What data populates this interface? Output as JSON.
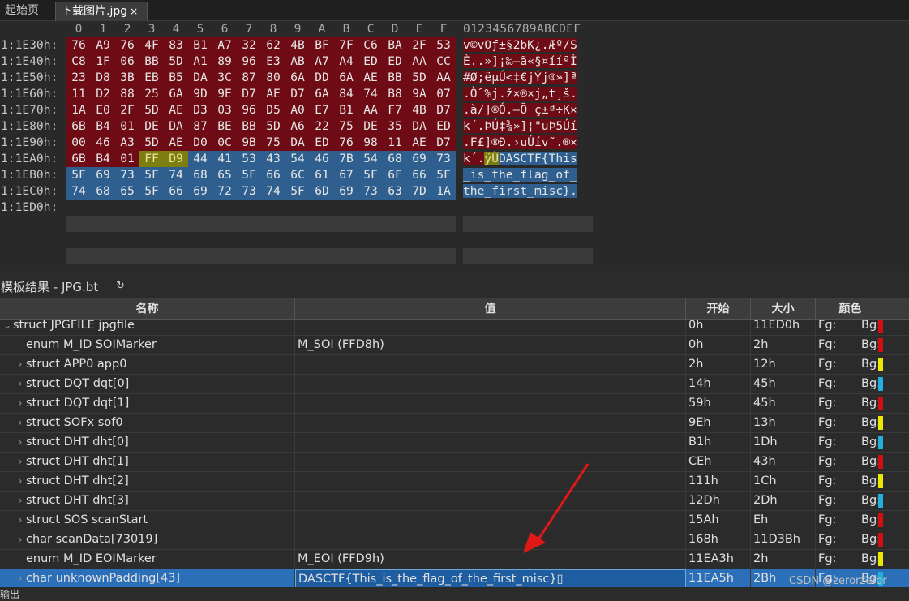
{
  "tabs": [
    {
      "label": "起始页",
      "close": ""
    },
    {
      "label": "下载图片.jpg",
      "close": "×"
    }
  ],
  "hex": {
    "col_headers": [
      "0",
      "1",
      "2",
      "3",
      "4",
      "5",
      "6",
      "7",
      "8",
      "9",
      "A",
      "B",
      "C",
      "D",
      "E",
      "F"
    ],
    "ascii_header": "0123456789ABCDEF",
    "rows": [
      {
        "addr": "1:1E30h:",
        "bytes": [
          "76",
          "A9",
          "76",
          "4F",
          "83",
          "B1",
          "A7",
          "32",
          "62",
          "4B",
          "BF",
          "7F",
          "C6",
          "BA",
          "2F",
          "53"
        ],
        "hl": [
          "r",
          "r",
          "r",
          "r",
          "r",
          "r",
          "r",
          "r",
          "r",
          "r",
          "r",
          "r",
          "r",
          "r",
          "r",
          "r"
        ],
        "ascii": "v©vOƒ±§2bK¿.Æº/S",
        "ascii_hl": "r"
      },
      {
        "addr": "1:1E40h:",
        "bytes": [
          "C8",
          "1F",
          "06",
          "BB",
          "5D",
          "A1",
          "89",
          "96",
          "E3",
          "AB",
          "A7",
          "A4",
          "ED",
          "ED",
          "AA",
          "CC"
        ],
        "hl": [
          "r",
          "r",
          "r",
          "r",
          "r",
          "r",
          "r",
          "r",
          "r",
          "r",
          "r",
          "r",
          "r",
          "r",
          "r",
          "r"
        ],
        "ascii": "È..»]¡‰–ã«§¤ííªÌ",
        "ascii_hl": "r"
      },
      {
        "addr": "1:1E50h:",
        "bytes": [
          "23",
          "D8",
          "3B",
          "EB",
          "B5",
          "DA",
          "3C",
          "87",
          "80",
          "6A",
          "DD",
          "6A",
          "AE",
          "BB",
          "5D",
          "AA"
        ],
        "hl": [
          "r",
          "r",
          "r",
          "r",
          "r",
          "r",
          "r",
          "r",
          "r",
          "r",
          "r",
          "r",
          "r",
          "r",
          "r",
          "r"
        ],
        "ascii": "#Ø;ëµÚ<‡€jÝj®»]ª",
        "ascii_hl": "r"
      },
      {
        "addr": "1:1E60h:",
        "bytes": [
          "11",
          "D2",
          "88",
          "25",
          "6A",
          "9D",
          "9E",
          "D7",
          "AE",
          "D7",
          "6A",
          "84",
          "74",
          "B8",
          "9A",
          "07"
        ],
        "hl": [
          "r",
          "r",
          "r",
          "r",
          "r",
          "r",
          "r",
          "r",
          "r",
          "r",
          "r",
          "r",
          "r",
          "r",
          "r",
          "r"
        ],
        "ascii": ".Òˆ%j.ž×®×j„t¸š.",
        "ascii_hl": "r"
      },
      {
        "addr": "1:1E70h:",
        "bytes": [
          "1A",
          "E0",
          "2F",
          "5D",
          "AE",
          "D3",
          "03",
          "96",
          "D5",
          "A0",
          "E7",
          "B1",
          "AA",
          "F7",
          "4B",
          "D7"
        ],
        "hl": [
          "r",
          "r",
          "r",
          "r",
          "r",
          "r",
          "r",
          "r",
          "r",
          "r",
          "r",
          "r",
          "r",
          "r",
          "r",
          "r"
        ],
        "ascii": ".à/]®Ó.–Õ ç±ª÷K×",
        "ascii_hl": "r"
      },
      {
        "addr": "1:1E80h:",
        "bytes": [
          "6B",
          "B4",
          "01",
          "DE",
          "DA",
          "87",
          "BE",
          "BB",
          "5D",
          "A6",
          "22",
          "75",
          "DE",
          "35",
          "DA",
          "ED"
        ],
        "hl": [
          "r",
          "r",
          "r",
          "r",
          "r",
          "r",
          "r",
          "r",
          "r",
          "r",
          "r",
          "r",
          "r",
          "r",
          "r",
          "r"
        ],
        "ascii": "k´.ÞÚ‡¾»]¦\"uÞ5Úí",
        "ascii_hl": "r"
      },
      {
        "addr": "1:1E90h:",
        "bytes": [
          "00",
          "46",
          "A3",
          "5D",
          "AE",
          "D0",
          "0C",
          "9B",
          "75",
          "DA",
          "ED",
          "76",
          "98",
          "11",
          "AE",
          "D7"
        ],
        "hl": [
          "r",
          "r",
          "r",
          "r",
          "r",
          "r",
          "r",
          "r",
          "r",
          "r",
          "r",
          "r",
          "r",
          "r",
          "r",
          "r"
        ],
        "ascii": ".F£]®Ð.›uÚív˜.®×",
        "ascii_hl": "r"
      },
      {
        "addr": "1:1EA0h:",
        "bytes": [
          "6B",
          "B4",
          "01",
          "FF",
          "D9",
          "44",
          "41",
          "53",
          "43",
          "54",
          "46",
          "7B",
          "54",
          "68",
          "69",
          "73"
        ],
        "hl": [
          "r",
          "r",
          "r",
          "y",
          "y",
          "b",
          "b",
          "b",
          "b",
          "b",
          "b",
          "b",
          "b",
          "b",
          "b",
          "b"
        ],
        "ascii": "k´.ÿÙDASCTF{This",
        "ascii_hl": "mix"
      },
      {
        "addr": "1:1EB0h:",
        "bytes": [
          "5F",
          "69",
          "73",
          "5F",
          "74",
          "68",
          "65",
          "5F",
          "66",
          "6C",
          "61",
          "67",
          "5F",
          "6F",
          "66",
          "5F"
        ],
        "hl": [
          "b",
          "b",
          "b",
          "b",
          "b",
          "b",
          "b",
          "b",
          "b",
          "b",
          "b",
          "b",
          "b",
          "b",
          "b",
          "b"
        ],
        "ascii": "_is_the_flag_of_",
        "ascii_hl": "b"
      },
      {
        "addr": "1:1EC0h:",
        "bytes": [
          "74",
          "68",
          "65",
          "5F",
          "66",
          "69",
          "72",
          "73",
          "74",
          "5F",
          "6D",
          "69",
          "73",
          "63",
          "7D",
          "1A"
        ],
        "hl": [
          "b",
          "b",
          "b",
          "b",
          "b",
          "b",
          "b",
          "b",
          "b",
          "b",
          "b",
          "b",
          "b",
          "b",
          "b",
          "b"
        ],
        "ascii": "the_first_misc}.",
        "ascii_hl": "b"
      },
      {
        "addr": "1:1ED0h:",
        "bytes": [],
        "hl": [],
        "ascii": "",
        "ascii_hl": ""
      }
    ]
  },
  "template": {
    "title": "模板结果 - JPG.bt",
    "refresh_icon": "↻",
    "columns": {
      "name": "名称",
      "value": "值",
      "start": "开始",
      "size": "大小",
      "color": "颜色"
    },
    "rows": [
      {
        "chev": "⌄",
        "indent": 0,
        "name": "struct JPGFILE jpgfile",
        "value": "",
        "start": "0h",
        "size": "11ED0h",
        "fg": "Fg:",
        "bg": "Bg:",
        "swatch": "#d01010"
      },
      {
        "chev": "",
        "indent": 1,
        "name": "enum M_ID SOIMarker",
        "value": "M_SOI (FFD8h)",
        "start": "0h",
        "size": "2h",
        "fg": "Fg:",
        "bg": "Bg:",
        "swatch": "#d01010"
      },
      {
        "chev": "›",
        "indent": 1,
        "name": "struct APP0 app0",
        "value": "",
        "start": "2h",
        "size": "12h",
        "fg": "Fg:",
        "bg": "Bg:",
        "swatch": "#e8e800"
      },
      {
        "chev": "›",
        "indent": 1,
        "name": "struct DQT dqt[0]",
        "value": "",
        "start": "14h",
        "size": "45h",
        "fg": "Fg:",
        "bg": "Bg:",
        "swatch": "#20b0e0"
      },
      {
        "chev": "›",
        "indent": 1,
        "name": "struct DQT dqt[1]",
        "value": "",
        "start": "59h",
        "size": "45h",
        "fg": "Fg:",
        "bg": "Bg:",
        "swatch": "#d01010"
      },
      {
        "chev": "›",
        "indent": 1,
        "name": "struct SOFx sof0",
        "value": "",
        "start": "9Eh",
        "size": "13h",
        "fg": "Fg:",
        "bg": "Bg:",
        "swatch": "#e8e800"
      },
      {
        "chev": "›",
        "indent": 1,
        "name": "struct DHT dht[0]",
        "value": "",
        "start": "B1h",
        "size": "1Dh",
        "fg": "Fg:",
        "bg": "Bg:",
        "swatch": "#20b0e0"
      },
      {
        "chev": "›",
        "indent": 1,
        "name": "struct DHT dht[1]",
        "value": "",
        "start": "CEh",
        "size": "43h",
        "fg": "Fg:",
        "bg": "Bg:",
        "swatch": "#d01010"
      },
      {
        "chev": "›",
        "indent": 1,
        "name": "struct DHT dht[2]",
        "value": "",
        "start": "111h",
        "size": "1Ch",
        "fg": "Fg:",
        "bg": "Bg:",
        "swatch": "#e8e800"
      },
      {
        "chev": "›",
        "indent": 1,
        "name": "struct DHT dht[3]",
        "value": "",
        "start": "12Dh",
        "size": "2Dh",
        "fg": "Fg:",
        "bg": "Bg:",
        "swatch": "#20b0e0"
      },
      {
        "chev": "›",
        "indent": 1,
        "name": "struct SOS scanStart",
        "value": "",
        "start": "15Ah",
        "size": "Eh",
        "fg": "Fg:",
        "bg": "Bg:",
        "swatch": "#d01010"
      },
      {
        "chev": "›",
        "indent": 1,
        "name": "char scanData[73019]",
        "value": "",
        "start": "168h",
        "size": "11D3Bh",
        "fg": "Fg:",
        "bg": "Bg:",
        "swatch": "#d01010"
      },
      {
        "chev": "",
        "indent": 1,
        "name": "enum M_ID EOIMarker",
        "value": "M_EOI (FFD9h)",
        "start": "11EA3h",
        "size": "2h",
        "fg": "Fg:",
        "bg": "Bg:",
        "swatch": "#e8e800"
      },
      {
        "chev": "›",
        "indent": 1,
        "name": "char unknownPadding[43]",
        "value": "DASCTF{This_is_the_flag_of_the_first_misc}▯",
        "start": "11EA5h",
        "size": "2Bh",
        "fg": "Fg:",
        "bg": "Bg:",
        "swatch": "#20b0e0",
        "selected": true
      }
    ]
  },
  "output_label": "输出",
  "watermark": "CSDN @zerorzeror",
  "colors": {
    "red_hl": "#6e0b14",
    "blue_hl": "#2e5f8f",
    "yellow_hl": "#7d7d10",
    "arrow": "#e01818"
  }
}
